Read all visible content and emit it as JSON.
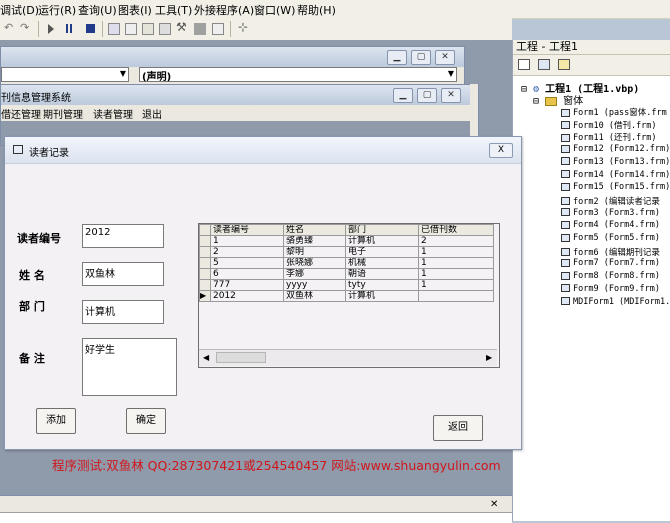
{
  "menubar": {
    "items": [
      "调试(D)",
      "运行(R)",
      "查询(U)",
      "图表(I)",
      "工具(T)",
      "外接程序(A)",
      "窗口(W)",
      "帮助(H)"
    ]
  },
  "code_window": {
    "object_combo": "",
    "proc_combo": "(声明)"
  },
  "mdi_window": {
    "title": "刊信息管理系统",
    "menus": [
      "借还管理",
      "期刊管理",
      "读者管理",
      "退出"
    ]
  },
  "project_explorer": {
    "title": "工程 - 工程1",
    "root": "工程1 (工程1.vbp)",
    "folder": "窗体",
    "forms": [
      "Form1 (pass窗体.frm",
      "Form10 (借刊.frm)",
      "Form11 (还刊.frm)",
      "Form12 (Form12.frm)",
      "Form13 (Form13.frm)",
      "Form14 (Form14.frm)",
      "Form15 (Form15.frm)",
      "form2 (编辑读者记录",
      "Form3 (Form3.frm)",
      "Form4 (Form4.frm)",
      "Form5 (Form5.frm)",
      "form6 (编辑期刊记录",
      "Form7 (Form7.frm)",
      "Form8 (Form8.frm)",
      "Form9 (Form9.frm)",
      "MDIForm1 (MDIForm1."
    ]
  },
  "dialog": {
    "title": "读者记录",
    "close": "X",
    "fields": {
      "reader_id_label": "读者编号",
      "reader_id_value": "2012",
      "name_label": "姓  名",
      "name_value": "双鱼林",
      "dept_label": "部  门",
      "dept_value": "计算机",
      "note_label": "备  注",
      "note_value": "好学生"
    },
    "buttons": {
      "add": "添加",
      "confirm": "确定",
      "back": "返回"
    },
    "grid": {
      "columns": [
        "读者编号",
        "姓名",
        "部门",
        "已借刊数"
      ],
      "rows": [
        [
          "1",
          "骆勇臻",
          "计算机",
          "2"
        ],
        [
          "2",
          "黎明",
          "电子",
          "1"
        ],
        [
          "5",
          "张晓娜",
          "机械",
          "1"
        ],
        [
          "6",
          "李娜",
          "朝语",
          "1"
        ],
        [
          "777",
          "yyyy",
          "tyty",
          "1"
        ],
        [
          "2012",
          "双鱼林",
          "计算机",
          ""
        ]
      ],
      "current_row_marker": "▶"
    }
  },
  "watermark": "程序测试:双鱼林 QQ:287307421或254540457 网站:www.shuangyulin.com",
  "colors": {
    "watermark": "#d1161b",
    "mdi_background": "#8f9aab",
    "dialog_background": "#f3f1f4"
  }
}
